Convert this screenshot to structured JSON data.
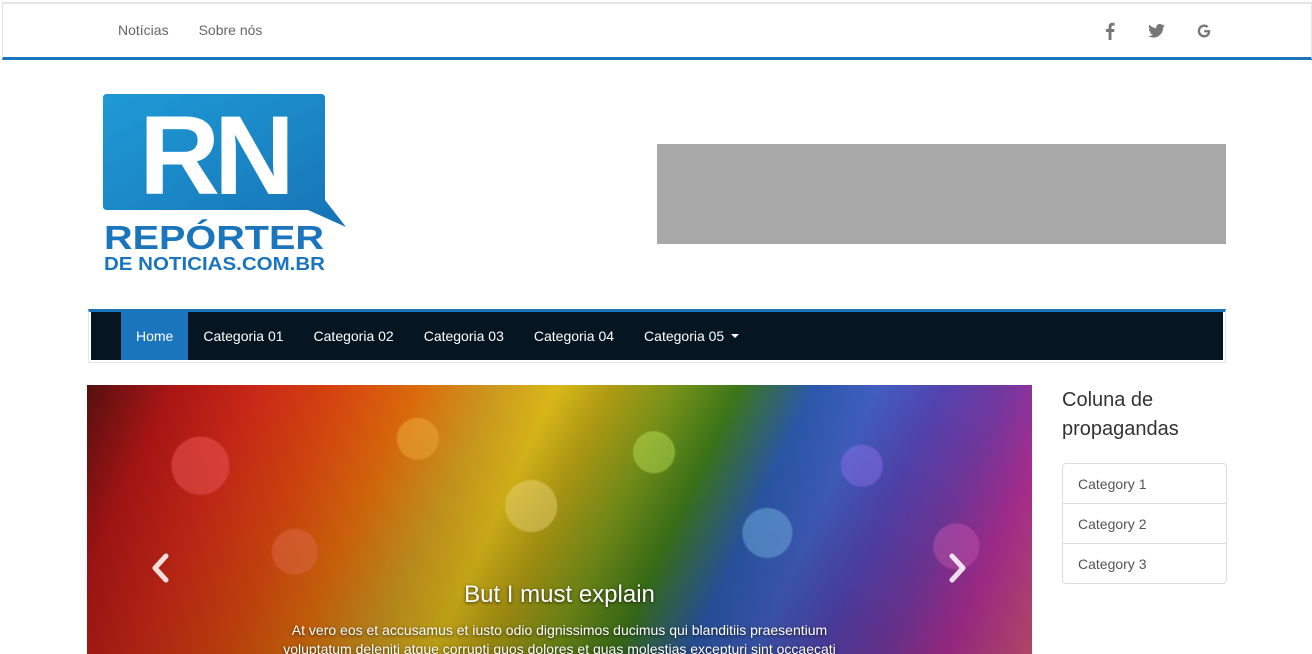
{
  "topbar": {
    "links": [
      "Notícias",
      "Sobre nós"
    ],
    "social": [
      "facebook-icon",
      "twitter-icon",
      "google-icon"
    ],
    "accent_color": "#1b75bc"
  },
  "logo": {
    "letters": "RN",
    "line1": "REPÓRTER",
    "line2": "DE NOTICIAS.COM.BR",
    "color": "#1b75bc"
  },
  "banner": {
    "color": "#a8a8a8"
  },
  "nav": {
    "items": [
      "Home",
      "Categoria 01",
      "Categoria 02",
      "Categoria 03",
      "Categoria 04",
      "Categoria 05"
    ],
    "active": "Home",
    "background": "#051521"
  },
  "carousel": {
    "title": "But I must explain",
    "text": "At vero eos et accusamus et iusto odio dignissimos ducimus qui blanditiis praesentium voluptatum deleniti atque corrupti quos dolores et quas molestias excepturi sint occaecati"
  },
  "sidebar": {
    "title": "Coluna de propagandas",
    "items": [
      "Category 1",
      "Category 2",
      "Category 3"
    ]
  }
}
